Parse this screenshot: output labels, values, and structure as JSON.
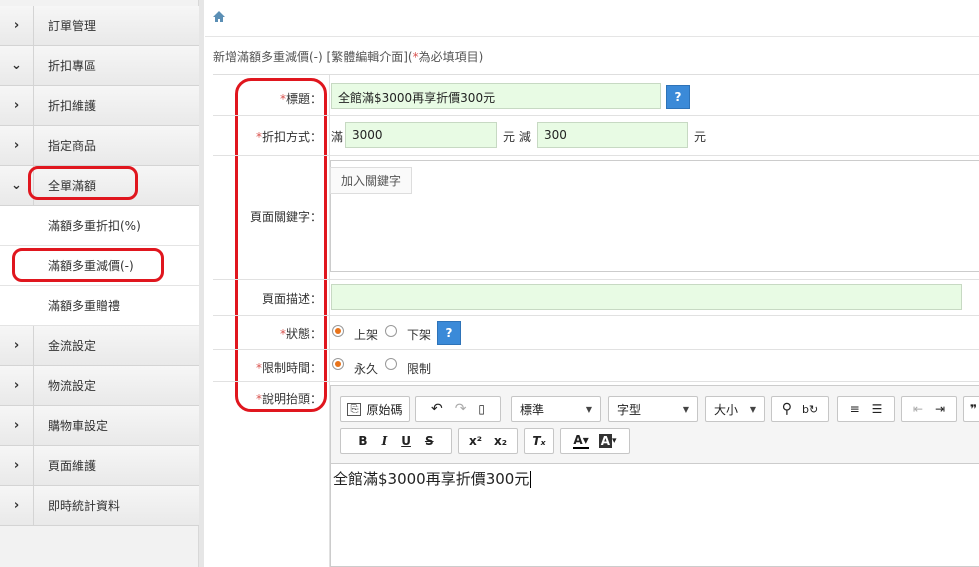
{
  "sidebar": {
    "items": [
      {
        "label": "訂單管理",
        "chevron": "›"
      },
      {
        "label": "折扣專區",
        "chevron": "⌄"
      },
      {
        "label": "折扣維護",
        "chevron": "›"
      },
      {
        "label": "指定商品",
        "chevron": "›"
      },
      {
        "label": "全單滿額",
        "chevron": "⌄"
      },
      {
        "label": "滿額多重折扣(%)"
      },
      {
        "label": "滿額多重減價(-)"
      },
      {
        "label": "滿額多重贈禮"
      },
      {
        "label": "金流設定",
        "chevron": "›"
      },
      {
        "label": "物流設定",
        "chevron": "›"
      },
      {
        "label": "購物車設定",
        "chevron": "›"
      },
      {
        "label": "頁面維護",
        "chevron": "›"
      },
      {
        "label": "即時統計資料",
        "chevron": "›"
      }
    ]
  },
  "breadcrumb": {
    "home_icon": "home-icon"
  },
  "heading": {
    "text": "新增滿額多重減價(-) [繁體編輯介面](",
    "req": "*",
    "tail": "為必填項目)"
  },
  "form": {
    "title": {
      "req": "*",
      "label": "標題：",
      "value": "全館滿$3000再享折價300元",
      "help": "?"
    },
    "method": {
      "req": "*",
      "label": "折扣方式：",
      "prefix": "滿",
      "amount": "3000",
      "mid": "元 減",
      "discount": "300",
      "suffix": "元"
    },
    "keywords": {
      "label": "頁面關鍵字：",
      "placeholder": "加入關鍵字"
    },
    "description": {
      "label": "頁面描述：",
      "value": ""
    },
    "status": {
      "req": "*",
      "label": "狀態：",
      "opt_on": "上架",
      "opt_off": "下架",
      "help": "?"
    },
    "period": {
      "req": "*",
      "label": "限制時間：",
      "opt_forever": "永久",
      "opt_limit": "限制"
    },
    "header": {
      "req": "*",
      "label": "說明抬頭："
    }
  },
  "editor": {
    "source_label": "原始碼",
    "format_label": "標準",
    "font_label": "字型",
    "size_label": "大小",
    "content": "全館滿$3000再享折價300元"
  },
  "colors": {
    "accent": "#3b8ad8",
    "required": "#d9534f",
    "highlight": "#e0161e",
    "field_bg": "#e8fbe4"
  }
}
